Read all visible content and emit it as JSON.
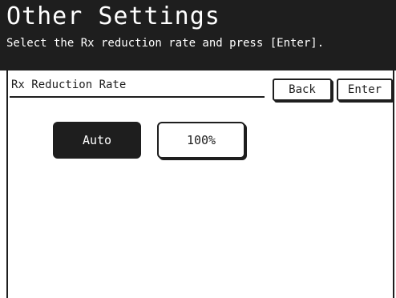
{
  "header": {
    "title": "Other Settings",
    "subtitle": "Select the Rx reduction rate and press [Enter]."
  },
  "section": {
    "label": "Rx Reduction Rate"
  },
  "toolbar": {
    "back_label": "Back",
    "enter_label": "Enter"
  },
  "options": [
    {
      "label": "Auto",
      "selected": true
    },
    {
      "label": "100%",
      "selected": false
    }
  ],
  "colors": {
    "dark": "#1e1e1e",
    "background": "#ffffff"
  }
}
